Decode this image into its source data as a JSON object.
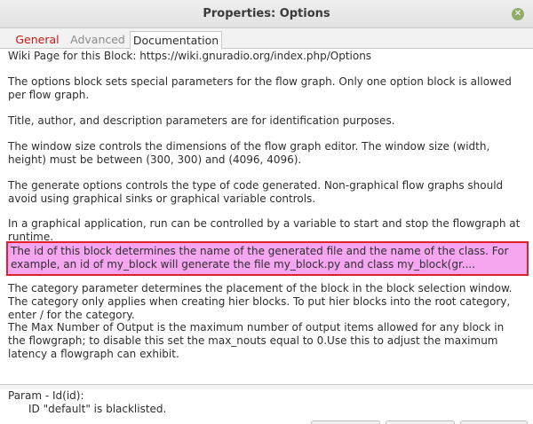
{
  "window": {
    "title": "Properties: Options"
  },
  "tabs": [
    {
      "label": "General"
    },
    {
      "label": "Advanced"
    },
    {
      "label": "Documentation"
    }
  ],
  "colors": {
    "active_error_tab": "#d21414",
    "highlight_fill": "#f6a5f1",
    "highlight_border": "#e0202a"
  },
  "documentation": {
    "wiki": "Wiki Page for this Block: https://wiki.gnuradio.org/index.php/Options",
    "options": "The options block sets special parameters for the flow graph. Only one option block is allowed per flow graph.",
    "title": "Title, author, and description parameters are for identification purposes.",
    "window": "The window size controls the dimensions of the flow graph editor. The window size (width, height) must be between (300, 300) and (4096, 4096).",
    "generate": "The generate options controls the type of code generated. Non-graphical flow graphs should avoid using graphical sinks or graphical variable controls.",
    "graphical": "In a graphical application, run can be controlled by a variable to start and stop the flowgraph at runtime.",
    "id": "The id of this block determines the name of the generated file and the name of the class. For example, an id of my_block will generate the file my_block.py and class my_block(gr....",
    "category": "The category parameter determines the placement of the block in the block selection window. The category only applies when creating hier blocks. To put hier blocks into the root category, enter / for the category.",
    "max_nouts": "The Max Number of Output is the maximum number of output items allowed for any block in the flowgraph; to disable this set the max_nouts equal to 0.Use this to adjust the maximum latency a flowgraph can exhibit."
  },
  "params": {
    "label": "Param - Id(id):",
    "message": "ID \"default\" is blacklisted."
  }
}
